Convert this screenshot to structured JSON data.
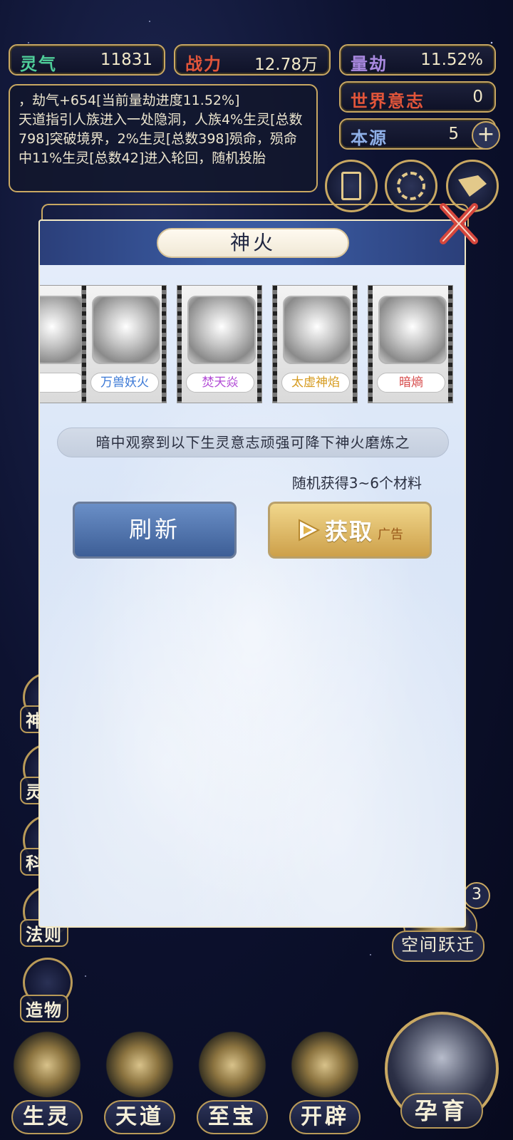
{
  "stats": {
    "lingqi": {
      "label": "灵气",
      "value": "11831",
      "color": "#4fcf9a"
    },
    "zhanli": {
      "label": "战力",
      "value": "12.78万",
      "color": "#e2553a"
    },
    "liangjie": {
      "label": "量劫",
      "value": "11.52%",
      "color": "#a989e0"
    },
    "shijie": {
      "label": "世界意志",
      "value": "0",
      "color": "#e2553a"
    },
    "benyuan": {
      "label": "本源",
      "value": "5",
      "color": "#8fb0e8"
    }
  },
  "log": {
    "line1": "，劫气+654[当前量劫进度11.52%]",
    "line2": "天道指引人族进入一处隐洞，人族4%生灵[总数798]突破境界，2%生灵[总数398]殒命，殒命中11%生灵[总数42]进入轮回，随机投胎"
  },
  "side_buttons": [
    "神",
    "灵",
    "科",
    "法则",
    "造物"
  ],
  "right_side": {
    "badge": "3",
    "label": "空间跃迁"
  },
  "bottom_nav": [
    "生灵",
    "天道",
    "至宝",
    "开辟",
    "孕育"
  ],
  "modal": {
    "title": "神火",
    "cards": [
      {
        "name": "",
        "color": "#3a78d6"
      },
      {
        "name": "万兽妖火",
        "color": "#3a78d6"
      },
      {
        "name": "焚天焱",
        "color": "#b24bd6"
      },
      {
        "name": "太虚神焰",
        "color": "#d69b1f"
      },
      {
        "name": "暗熵",
        "color": "#d64a4a"
      }
    ],
    "info": "暗中观察到以下生灵意志顽强可降下神火磨炼之",
    "reward": "随机获得3~6个材料",
    "refresh_label": "刷新",
    "get_label": "获取",
    "ad_label": "广告"
  }
}
